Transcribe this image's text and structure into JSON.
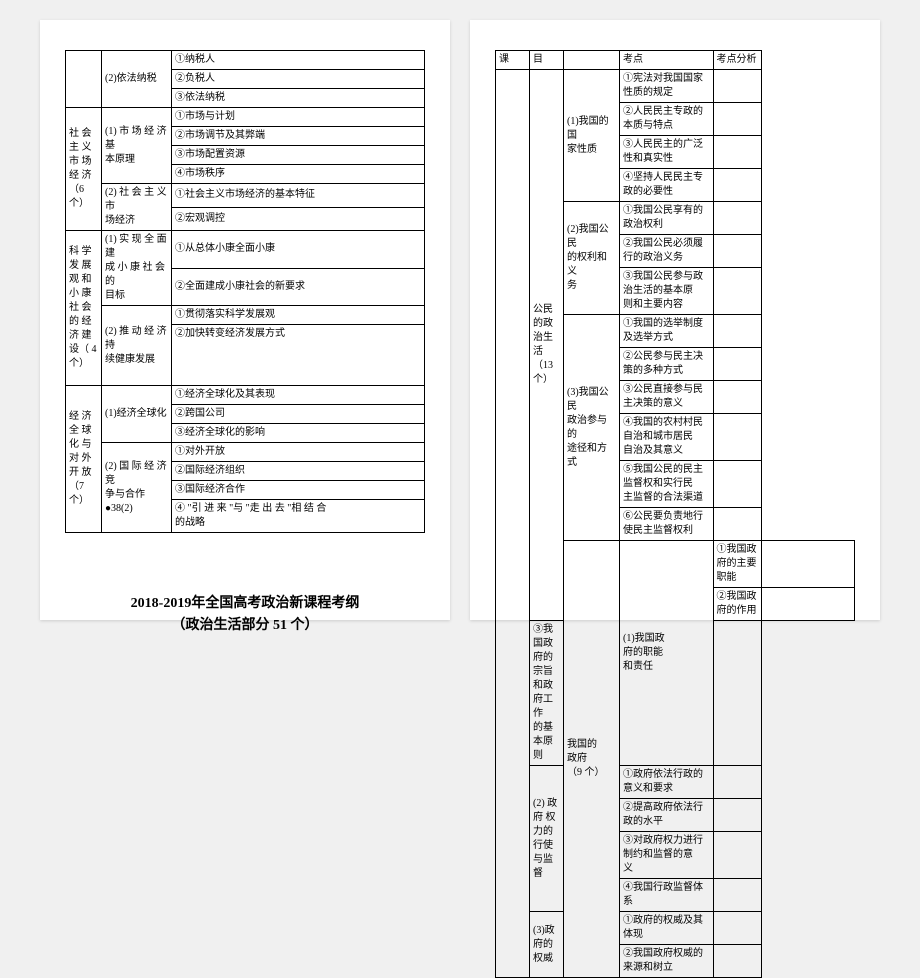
{
  "title": {
    "line1": "2018-2019年全国高考政治新课程考纲",
    "line2": "（政治生活部分 51 个）"
  },
  "leftTable": {
    "rows": [
      {
        "c1": "",
        "c1rs": 3,
        "c2": "(2)依法纳税",
        "c2rs": 3,
        "c3": "①纳税人"
      },
      {
        "c3": "②负税人"
      },
      {
        "c3": "③依法纳税"
      },
      {
        "c1": "社 会\n主 义\n市 场\n经 济\n（6 个）",
        "c1rs": 6,
        "c2": "(1) 市 场 经 济 基\n本原理",
        "c2rs": 4,
        "c3": "①市场与计划"
      },
      {
        "c3": "②市场调节及其弊端"
      },
      {
        "c3": "③市场配置资源"
      },
      {
        "c3": "④市场秩序"
      },
      {
        "c2": "(2) 社 会 主 义 市\n场经济",
        "c2rs": 2,
        "c3": "①社会主义市场经济的基本特征"
      },
      {
        "c3": "②宏观调控"
      },
      {
        "c1": "科 学\n发 展\n观 和\n小 康\n社 会\n的 经\n济 建\n设（ 4\n个）",
        "c1rs": 4,
        "c2": "(1) 实 现 全 面 建\n成 小 康 社 会 的\n目标",
        "c2rs": 2,
        "c3": "①从总体小康全面小康"
      },
      {
        "c3": "②全面建成小康社会的新要求"
      },
      {
        "c2": "(2) 推 动 经 济 持\n续健康发展",
        "c2rs": 2,
        "c3": "①贯彻落实科学发展观"
      },
      {
        "c3": "②加快转变经济发展方式\n\n\n\n"
      },
      {
        "c1": "经 济\n全 球\n化 与\n对 外\n开 放\n（7 个）",
        "c1rs": 7,
        "c2": "(1)经济全球化",
        "c2rs": 3,
        "c3": "①经济全球化及其表现"
      },
      {
        "c3": "②跨国公司"
      },
      {
        "c3": "③经济全球化的影响"
      },
      {
        "c2": "(2) 国 际 经 济 竞\n争与合作\n●38(2)",
        "c2rs": 4,
        "c3": "①对外开放"
      },
      {
        "c3": "②国际经济组织"
      },
      {
        "c3": "③国际经济合作"
      },
      {
        "c3": "④ \"引 进 来 \"与 \"走 出 去 \"相 结 合\n的战略"
      }
    ]
  },
  "rightTable": {
    "header": {
      "h1": "课",
      "h2": "目",
      "h3": "",
      "h4": "考点",
      "h5": "考点分析"
    },
    "rows": [
      {
        "c1": "",
        "c1rs": 24,
        "c2": "公民\n的政\n治生\n活\n（13\n个）",
        "c2rs": 15,
        "c3": "(1)我国的国\n家性质",
        "c3rs": 4,
        "c4": "①宪法对我国国家性质的规定"
      },
      {
        "c4": "②人民民主专政的本质与特点"
      },
      {
        "c4": "③人民民主的广泛性和真实性"
      },
      {
        "c4": "④坚持人民民主专政的必要性"
      },
      {
        "c3": "(2)我国公民\n的权利和义\n务",
        "c3rs": 3,
        "c4": "①我国公民享有的政治权利"
      },
      {
        "c4": "②我国公民必须履行的政治义务"
      },
      {
        "c4": "③我国公民参与政治生活的基本原\n则和主要内容"
      },
      {
        "c3": "(3)我国公民\n政治参与的\n途径和方式",
        "c3rs": 6,
        "c4": "①我国的选举制度及选举方式"
      },
      {
        "c4": "②公民参与民主决策的多种方式"
      },
      {
        "c4": "③公民直接参与民主决策的意义"
      },
      {
        "c4": "④我国的农村村民自治和城市居民\n自治及其意义"
      },
      {
        "c4": "⑤我国公民的民主监督权和实行民\n主监督的合法渠道"
      },
      {
        "c4": "⑥公民要负责地行使民主监督权利"
      },
      {
        "c1hide": true,
        "c2": "我国的\n政府\n（9 个）",
        "c2rs": 9,
        "c3": "(1)我国政\n府的职能\n和责任",
        "c3rs": 3,
        "c4": "①我国政府的主要职能"
      },
      {
        "c4": "②我国政府的作用"
      },
      {
        "c4": "③我国政府的宗旨和政府工作\n的基本原则"
      },
      {
        "c3": "(2) 政 府 权\n力的行使\n与监督",
        "c3rs": 4,
        "c4": "①政府依法行政的意义和要求"
      },
      {
        "c4": "②提高政府依法行政的水平"
      },
      {
        "c4": "③对政府权力进行制约和监督的意\n义"
      },
      {
        "c4": "④我国行政监督体系"
      },
      {
        "c3": "(3)政府的\n权威",
        "c3rs": 2,
        "c4": "①政府的权威及其体现"
      },
      {
        "c4": "②我国政府权威的来源和树立"
      }
    ]
  }
}
